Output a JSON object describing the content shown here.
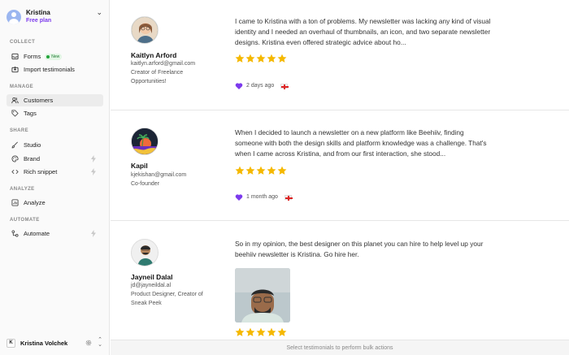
{
  "account": {
    "name": "Kristina",
    "plan": "Free plan"
  },
  "sidebar": {
    "sections": [
      {
        "title": "COLLECT",
        "items": [
          {
            "label": "Forms",
            "icon": "inbox-icon",
            "badge": "New"
          },
          {
            "label": "Import testimonials",
            "icon": "import-icon"
          }
        ]
      },
      {
        "title": "MANAGE",
        "items": [
          {
            "label": "Customers",
            "icon": "users-icon",
            "active": true
          },
          {
            "label": "Tags",
            "icon": "tag-icon"
          }
        ]
      },
      {
        "title": "SHARE",
        "items": [
          {
            "label": "Studio",
            "icon": "brush-icon"
          },
          {
            "label": "Brand",
            "icon": "palette-icon",
            "locked": true
          },
          {
            "label": "Rich snippet",
            "icon": "code-icon",
            "locked": true
          }
        ]
      },
      {
        "title": "ANALYZE",
        "items": [
          {
            "label": "Analyze",
            "icon": "chart-icon"
          }
        ]
      },
      {
        "title": "AUTOMATE",
        "items": [
          {
            "label": "Automate",
            "icon": "automation-icon",
            "locked": true
          }
        ]
      }
    ],
    "user": {
      "name": "Kristina Volchek"
    }
  },
  "testimonials": [
    {
      "name": "Kaitlyn Arford",
      "email": "kaitlyn.arford@gmail.com",
      "title": "Creator of Freelance Opportunities!",
      "quote": "I came to Kristina with a ton of problems. My newsletter was lacking any kind of visual identity and I needed an overhaul of thumbnails, an icon, and two separate newsletter designs. Kristina even offered strategic advice about ho...",
      "rating": 5,
      "time": "2 days ago"
    },
    {
      "name": "Kapil",
      "email": "kjekishan@gmail.com",
      "title": "Co-founder",
      "quote": "When I decided to launch a newsletter on a new platform like Beehiiv, finding someone with both the design skills and platform knowledge was a challenge. That's when I came across Kristina, and from our first interaction, she stood...",
      "rating": 5,
      "time": "1 month ago"
    },
    {
      "name": "Jayneil Dalal",
      "email": "jd@jayneildal.al",
      "title": "Product Designer, Creator of Sneak Peek",
      "quote": "So in my opinion, the best designer on this planet you can hire to help level up your beehiiv newsletter is Kristina. Go hire her.",
      "rating": 5
    }
  ],
  "bulk_bar": {
    "text": "Select testimonials to perform bulk actions"
  },
  "colors": {
    "accent": "#7c3aed",
    "star": "#f5b800",
    "heart": "#7c3aed"
  }
}
